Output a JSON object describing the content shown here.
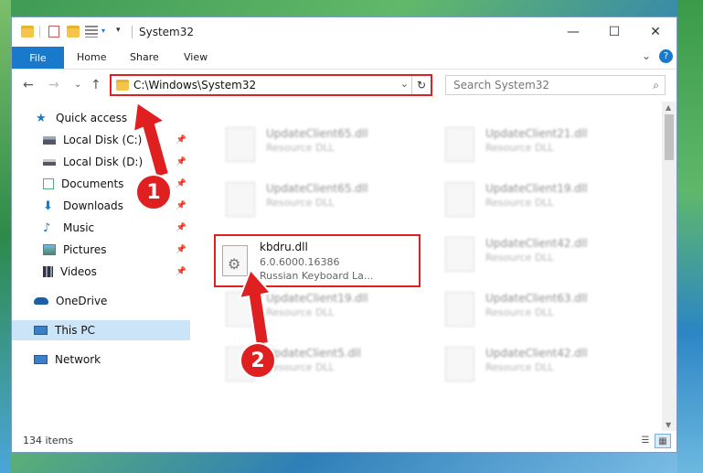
{
  "window": {
    "title": "System32",
    "controls": {
      "minimize": "—",
      "maximize": "☐",
      "close": "✕"
    }
  },
  "ribbon": {
    "file": "File",
    "tabs": [
      "Home",
      "Share",
      "View"
    ],
    "expand": "⌄",
    "help": "?"
  },
  "nav": {
    "back": "←",
    "forward": "→",
    "recent": "⌄",
    "up": "↑"
  },
  "address": {
    "path": "C:\\Windows\\System32",
    "dropdown": "⌄",
    "refresh": "↻"
  },
  "search": {
    "placeholder": "Search System32",
    "icon": "⌕"
  },
  "sidebar": {
    "pin": "📌",
    "items": [
      {
        "label": "Quick access",
        "icon": "star-icon"
      },
      {
        "label": "Local Disk (C:)",
        "icon": "drive-icon"
      },
      {
        "label": "Local Disk (D:)",
        "icon": "drive-icon"
      },
      {
        "label": "Documents",
        "icon": "documents-icon"
      },
      {
        "label": "Downloads",
        "icon": "download-icon"
      },
      {
        "label": "Music",
        "icon": "music-icon"
      },
      {
        "label": "Pictures",
        "icon": "pictures-icon"
      },
      {
        "label": "Videos",
        "icon": "videos-icon"
      },
      {
        "label": "OneDrive",
        "icon": "cloud-icon"
      },
      {
        "label": "This PC",
        "icon": "computer-icon"
      },
      {
        "label": "Network",
        "icon": "network-icon"
      }
    ]
  },
  "files": {
    "blurred": [
      {
        "name": "UpdateClient65.dll",
        "desc": "Resource DLL"
      },
      {
        "name": "UpdateClient21.dll",
        "desc": "Resource DLL"
      },
      {
        "name": "UpdateClient65.dll",
        "desc": "Resource DLL"
      },
      {
        "name": "UpdateClient19.dll",
        "desc": "Resource DLL"
      },
      {
        "name": "UpdateClient42.dll",
        "desc": "Resource DLL"
      },
      {
        "name": "UpdateClient19.dll",
        "desc": "Resource DLL"
      },
      {
        "name": "UpdateClient63.dll",
        "desc": "Resource DLL"
      },
      {
        "name": "UpdateClient5.dll",
        "desc": "Resource DLL"
      },
      {
        "name": "UpdateClient42.dll",
        "desc": "Resource DLL"
      }
    ],
    "highlighted": {
      "name": "kbdru.dll",
      "version": "6.0.6000.16386",
      "description": "Russian Keyboard La..."
    }
  },
  "status": {
    "items": "134 items"
  },
  "callouts": [
    "1",
    "2"
  ],
  "colors": {
    "accent": "#1979ca",
    "highlight": "#e02020",
    "selected": "#cce4f7"
  }
}
